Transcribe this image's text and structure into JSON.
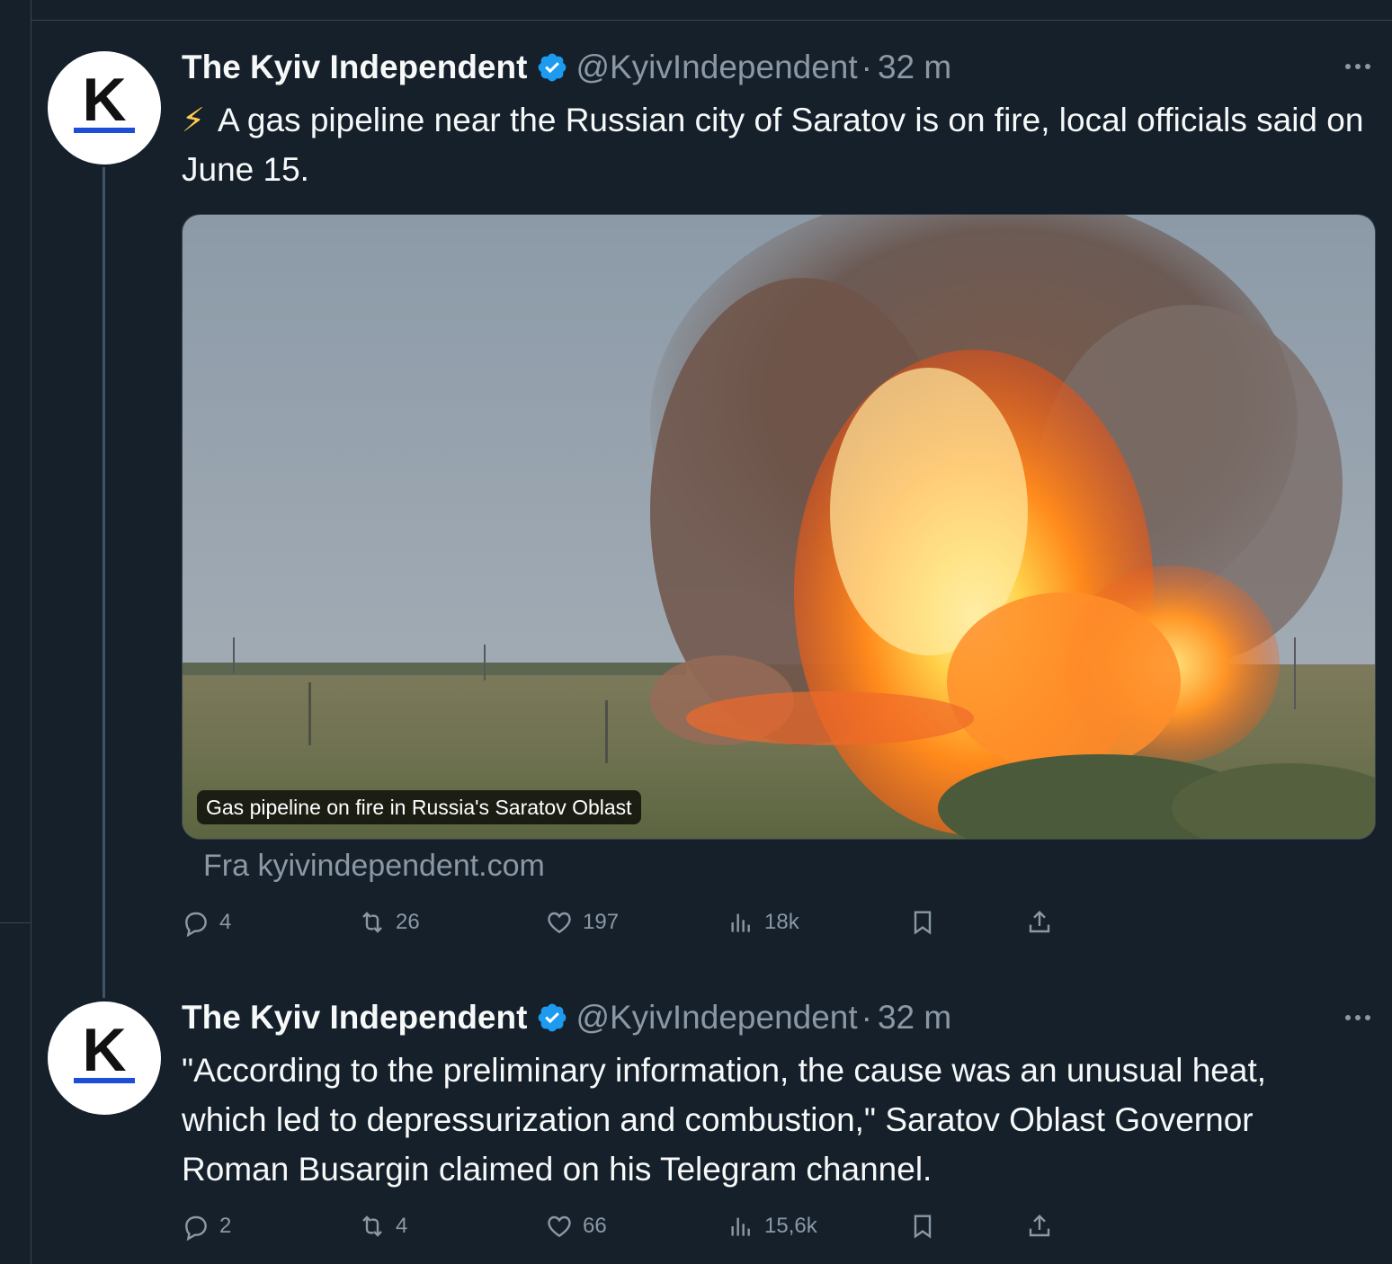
{
  "tweets": [
    {
      "author": "The Kyiv Independent",
      "handle": "@KyivIndependent",
      "separator": "·",
      "time": "32 m",
      "avatar_letter": "K",
      "emoji": "⚡",
      "text": "A gas pipeline near the Russian city of Saratov is on fire, local officials said on June 15.",
      "media": {
        "caption": "Gas pipeline on fire in Russia's Saratov Oblast",
        "description": "Large orange fireball and dark smoke column rising from a gas pipeline in a grassy field"
      },
      "source": "Fra kyivindependent.com",
      "stats": {
        "replies": "4",
        "reposts": "26",
        "likes": "197",
        "views": "18k"
      }
    },
    {
      "author": "The Kyiv Independent",
      "handle": "@KyivIndependent",
      "separator": "·",
      "time": "32 m",
      "avatar_letter": "K",
      "text": "\"According to the preliminary information, the cause was an unusual heat, which led to depressurization and combustion,\" Saratov Oblast Governor Roman Busargin claimed on his Telegram channel.",
      "stats": {
        "replies": "2",
        "reposts": "4",
        "likes": "66",
        "views": "15,6k"
      }
    }
  ],
  "colors": {
    "background": "#15202b",
    "border": "#38444d",
    "secondary_text": "#8b98a5",
    "verified": "#1d9bf0",
    "avatar_accent": "#1d4ed8"
  },
  "icons": [
    "verified-badge-icon",
    "more-icon",
    "reply-icon",
    "repost-icon",
    "like-icon",
    "views-icon",
    "bookmark-icon",
    "share-icon",
    "lightning-icon"
  ]
}
